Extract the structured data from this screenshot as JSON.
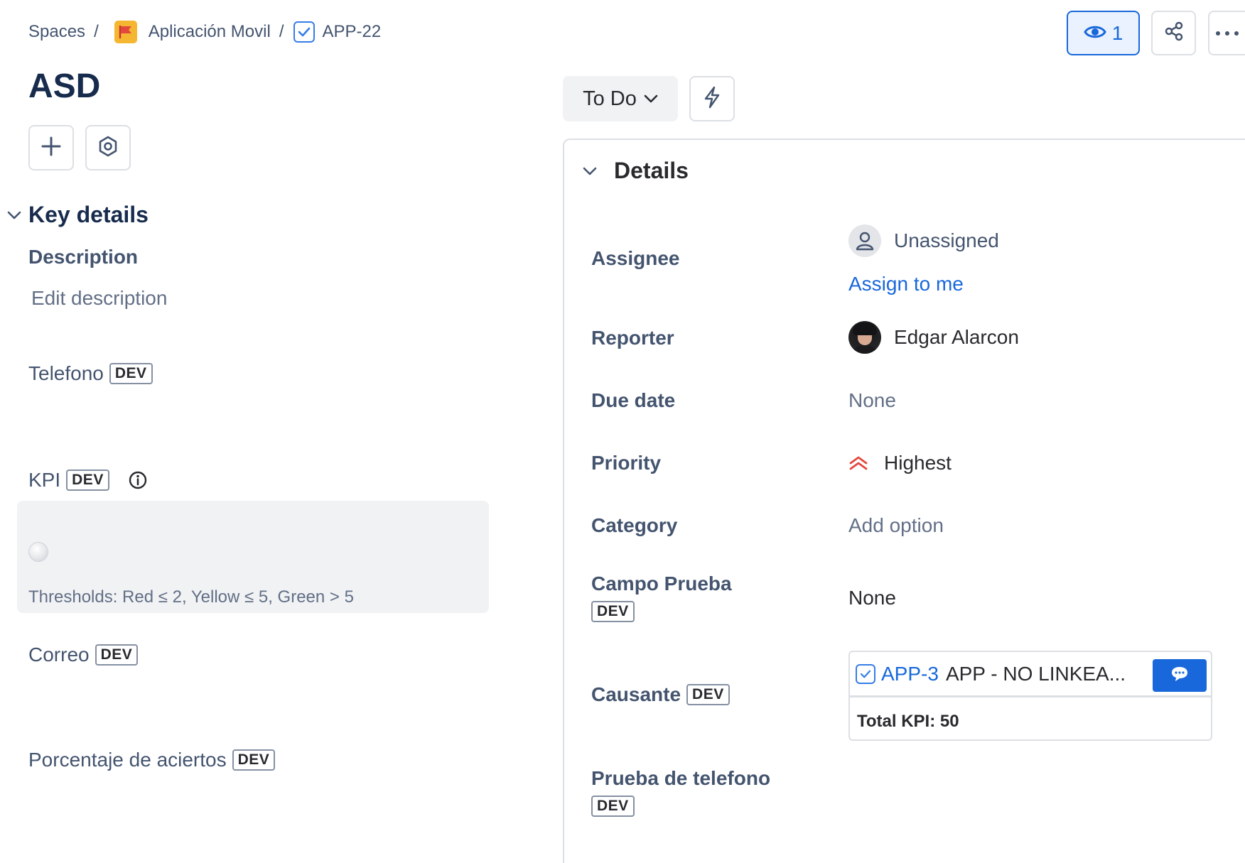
{
  "breadcrumb": {
    "spaces": "Spaces",
    "separator": "/",
    "project": "Aplicación Movil",
    "issue_key": "APP-22"
  },
  "header": {
    "watch_count": "1"
  },
  "issue": {
    "title": "ASD",
    "status": "To Do"
  },
  "key_details": {
    "heading": "Key details",
    "description_label": "Description",
    "description_placeholder": "Edit description",
    "badge": "DEV",
    "fields": {
      "telefono": "Telefono",
      "kpi": "KPI",
      "correo": "Correo",
      "porcentaje": "Porcentaje de aciertos"
    },
    "kpi_thresholds": "Thresholds: Red ≤ 2, Yellow ≤ 5, Green > 5"
  },
  "details": {
    "heading": "Details",
    "assignee": {
      "label": "Assignee",
      "value": "Unassigned",
      "action": "Assign to me"
    },
    "reporter": {
      "label": "Reporter",
      "value": "Edgar Alarcon"
    },
    "due_date": {
      "label": "Due date",
      "value": "None"
    },
    "priority": {
      "label": "Priority",
      "value": "Highest",
      "color": "#e2483d"
    },
    "category": {
      "label": "Category",
      "value": "Add option"
    },
    "campo_prueba": {
      "label": "Campo Prueba",
      "value": "None"
    },
    "causante": {
      "label": "Causante",
      "linked_key": "APP-3",
      "linked_summary": "APP - NO LINKEA...",
      "total_kpi": "Total KPI: 50"
    },
    "prueba_telefono": {
      "label": "Prueba de telefono"
    }
  },
  "colors": {
    "accent": "#1868db",
    "border": "#dcdfe4",
    "space_icon": "#f5b731"
  }
}
